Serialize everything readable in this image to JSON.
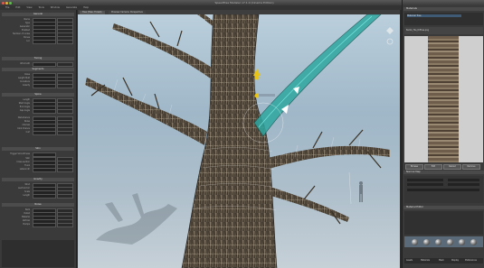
{
  "window": {
    "title": "SpeedTree Modeler v7.1.0 (Cinema Edition)"
  },
  "menu": {
    "items": [
      "File",
      "Edit",
      "View",
      "Tools",
      "Window",
      "Generate",
      "Help"
    ]
  },
  "left_panel": {
    "sections": [
      {
        "title": "General",
        "rows": [
          "Name",
          "Type",
          "Generator",
          "Enabled",
          "Number of nodes",
          "Bones",
          "Loc"
        ]
      },
      {
        "title": "Tuning",
        "rows": [
          "Wind LOD"
        ]
      },
      {
        "title": "Segments",
        "rows": [
          "Rows",
          "Length Mult",
          "Curvature",
          "Gravity"
        ]
      },
      {
        "title": "Spine",
        "rows": [
          "Length",
          "Start Angle",
          "End Angle",
          "Cap Angle",
          "Disturbance",
          "Noise",
          "Interval",
          "Kink Chance",
          "Curl"
        ]
      },
      {
        "title": "Skin",
        "rows": [
          "Trigger Smoothness",
          "Skin",
          "Cross-section",
          "Trunk",
          "Lateral dir"
        ]
      },
      {
        "title": "Gravity",
        "rows": [
          "Wind",
          "Leaf Anchor",
          "Scale",
          "Length",
          "Texture",
          "Mesh"
        ]
      },
      {
        "title": "Noise",
        "rows": [
          "Bark",
          "Detail",
          "Material",
          "Vertical",
          "Bumps"
        ]
      }
    ]
  },
  "viewport": {
    "tabs": [
      "Tree (Tree: Forest)",
      "Preview Camera: Perspective"
    ]
  },
  "right_panel": {
    "header": "Materials",
    "sub_header": "Material Tree",
    "texture_label": "BarkA_Tile_Diffuse.png",
    "buttons": [
      "Browse",
      "Edit",
      "Reload",
      "Remove"
    ],
    "section2": "Normal Map",
    "section3": "Material Editor",
    "bottom_tabs": [
      "Assets",
      "Materials",
      "Mesh",
      "Display",
      "Preferences"
    ]
  },
  "colors": {
    "accent_yellow": "#e8c419",
    "mesh_teal": "#2fa7a0"
  }
}
